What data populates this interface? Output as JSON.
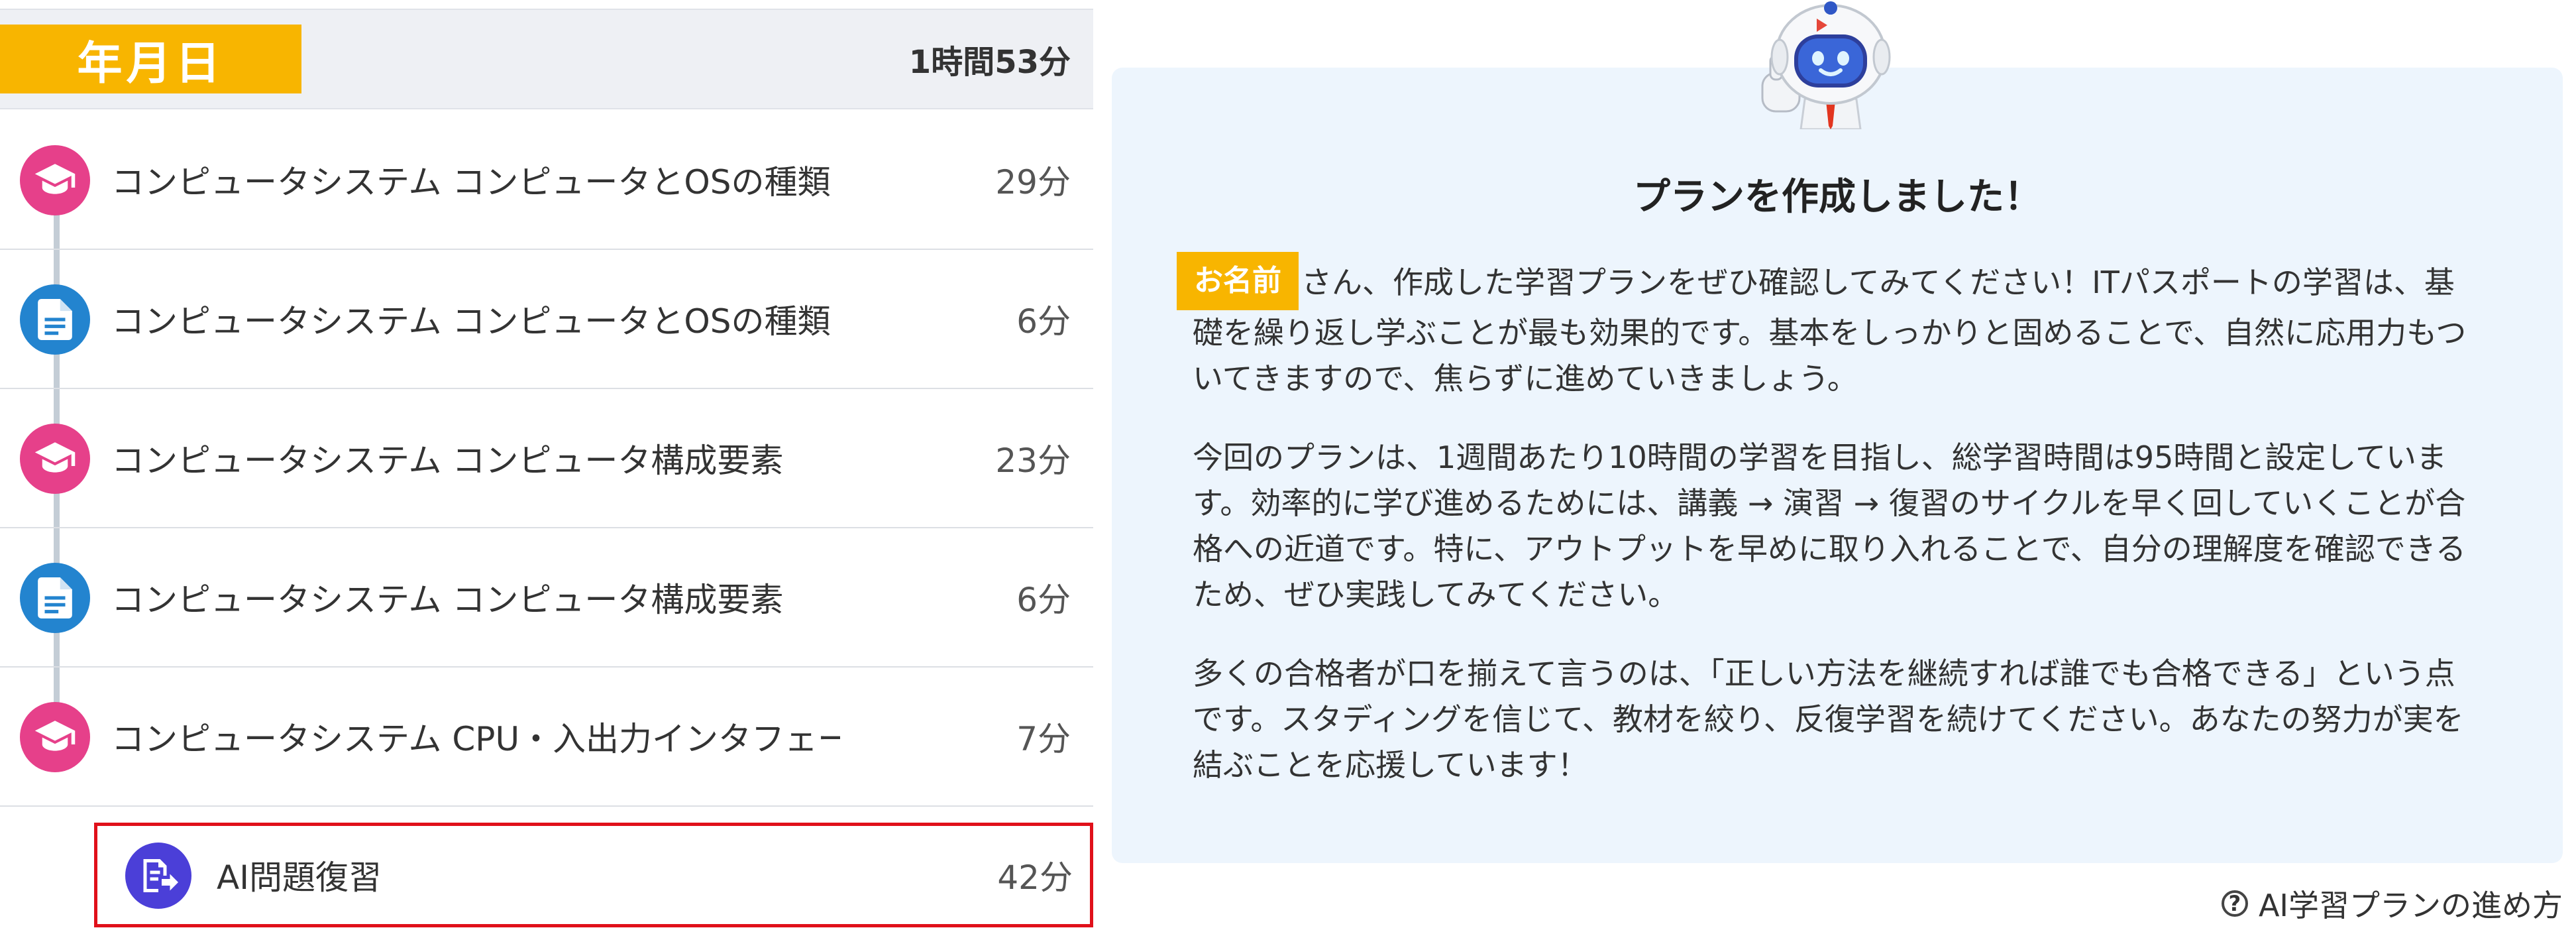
{
  "schedule": {
    "date_label": "年月日",
    "total_time": "1時間53分",
    "lessons": [
      {
        "title": "コンピュータシステム コンピュータとOSの種類",
        "duration": "29分",
        "type": "lecture"
      },
      {
        "title": "コンピュータシステム コンピュータとOSの種類",
        "duration": "6分",
        "type": "exercise"
      },
      {
        "title": "コンピュータシステム コンピュータ構成要素",
        "duration": "23分",
        "type": "lecture"
      },
      {
        "title": "コンピュータシステム コンピュータ構成要素",
        "duration": "6分",
        "type": "exercise"
      },
      {
        "title": "コンピュータシステム CPU・入出力インタフェース",
        "duration": "7分",
        "type": "lecture"
      }
    ],
    "ai_review": {
      "title": "AI問題復習",
      "duration": "42分"
    }
  },
  "message": {
    "title": "プランを作成しました！",
    "name_badge": "お名前",
    "paragraphs": [
      "さん、作成した学習プランをぜひ確認してみてください！ITパスポートの学習は、基礎を繰り返し学ぶことが最も効果的です。基本をしっかりと固めることで、自然に応用力もついてきますので、焦らずに進めていきましょう。",
      "今回のプランは、1週間あたり10時間の学習を目指し、総学習時間は95時間と設定しています。効率的に学び進めるためには、講義 → 演習 → 復習のサイクルを早く回していくことが合格への近道です。特に、アウトプットを早めに取り入れることで、自分の理解度を確認できるため、ぜひ実践してみてください。",
      "多くの合格者が口を揃えて言うのは、「正しい方法を継続すれば誰でも合格できる」という点です。スタディングを信じて、教材を絞り、反復学習を続けてください。あなたの努力が実を結ぶことを応援しています！"
    ]
  },
  "guide_link": {
    "label": "AI学習プランの進め方"
  },
  "icons": {
    "lecture": "graduation-cap-icon",
    "exercise": "document-icon",
    "ai_review": "ai-review-icon",
    "help": "help-circle-icon",
    "mascot": "robot-mascot-icon"
  },
  "colors": {
    "accent_yellow": "#f8b500",
    "lecture_pink": "#e6408a",
    "exercise_blue": "#2384cf",
    "ai_purple": "#4b3fd8",
    "highlight_red": "#e0101a",
    "card_bg": "#edf5fd"
  }
}
